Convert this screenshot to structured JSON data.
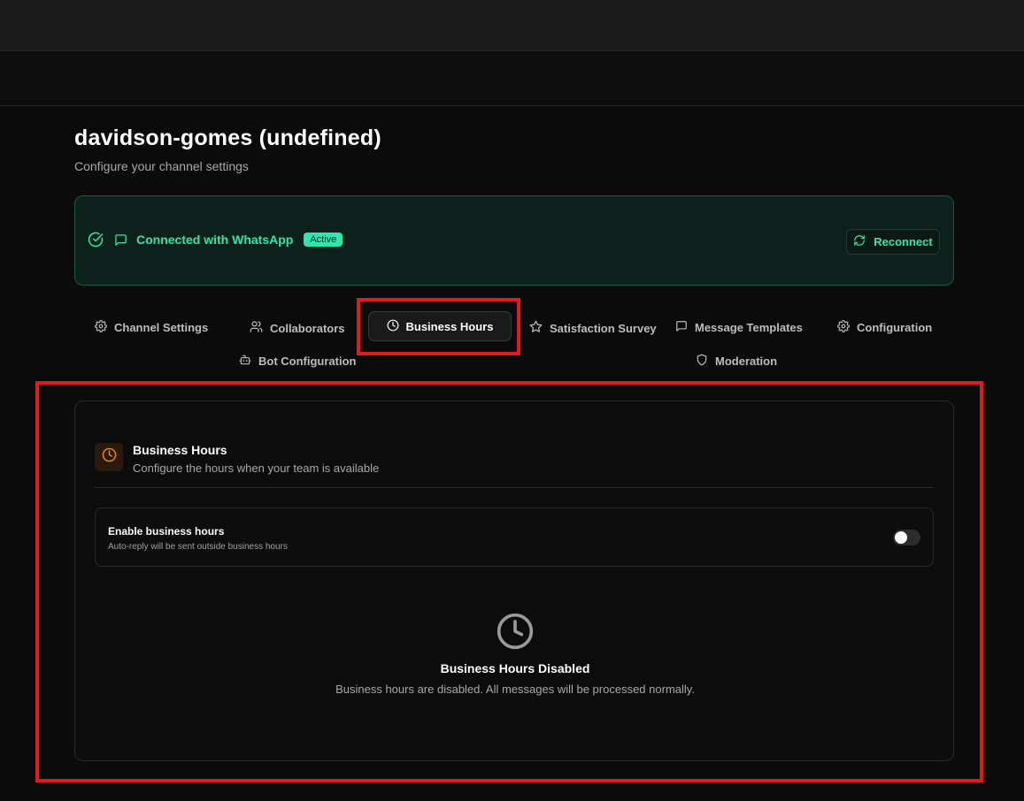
{
  "page": {
    "title": "davidson-gomes (undefined)",
    "subtitle": "Configure your channel settings"
  },
  "connection": {
    "status_text": "Connected with WhatsApp",
    "badge": "Active",
    "reconnect_label": "Reconnect",
    "accent_color": "#2ee6ae"
  },
  "tabs": [
    {
      "label": "Channel Settings",
      "icon": "gear-icon",
      "active": false
    },
    {
      "label": "Collaborators",
      "icon": "users-icon",
      "active": false
    },
    {
      "label": "Business Hours",
      "icon": "clock-icon",
      "active": true
    },
    {
      "label": "Satisfaction Survey",
      "icon": "star-icon",
      "active": false
    },
    {
      "label": "Message Templates",
      "icon": "message-square-icon",
      "active": false
    },
    {
      "label": "Configuration",
      "icon": "gear-icon",
      "active": false
    },
    {
      "label": "Bot Configuration",
      "icon": "bot-icon",
      "active": false
    },
    {
      "label": "Moderation",
      "icon": "shield-icon",
      "active": false
    }
  ],
  "business_hours": {
    "title": "Business Hours",
    "description": "Configure the hours when your team is available",
    "toggle_label": "Enable business hours",
    "toggle_help": "Auto-reply will be sent outside business hours",
    "enabled": false,
    "disabled_title": "Business Hours Disabled",
    "disabled_message": "Business hours are disabled. All messages will be processed normally.",
    "icon_color": "#f08a1c"
  },
  "highlight_color": "#e01b1b"
}
